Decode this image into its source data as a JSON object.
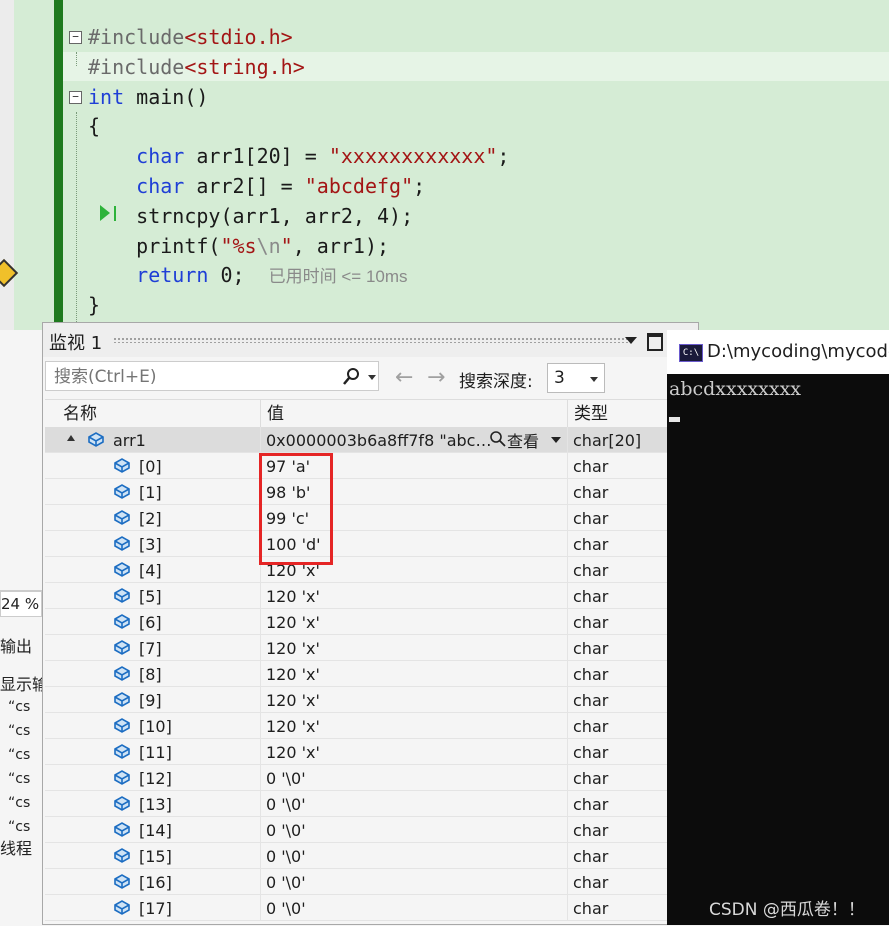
{
  "editor": {
    "lines": [
      {
        "fold": "−",
        "parts": [
          {
            "c": "inc",
            "t": "#include"
          },
          {
            "c": "ang",
            "t": "<"
          },
          {
            "c": "str",
            "t": "stdio.h"
          },
          {
            "c": "ang",
            "t": ">"
          }
        ]
      },
      {
        "parts": [
          {
            "c": "inc",
            "t": "#include"
          },
          {
            "c": "ang",
            "t": "<"
          },
          {
            "c": "str",
            "t": "string.h"
          },
          {
            "c": "ang",
            "t": ">"
          }
        ]
      },
      {
        "fold": "−",
        "parts": [
          {
            "c": "kw",
            "t": "int"
          },
          {
            "c": "",
            "t": " main()"
          }
        ]
      },
      {
        "parts": [
          {
            "c": "",
            "t": "{"
          }
        ]
      },
      {
        "parts": [
          {
            "c": "",
            "t": "    "
          },
          {
            "c": "kw",
            "t": "char"
          },
          {
            "c": "",
            "t": " arr1[20] = "
          },
          {
            "c": "str",
            "t": "\"xxxxxxxxxxxx\""
          },
          {
            "c": "",
            "t": ";"
          }
        ]
      },
      {
        "parts": [
          {
            "c": "",
            "t": "    "
          },
          {
            "c": "kw",
            "t": "char"
          },
          {
            "c": "",
            "t": " arr2[] = "
          },
          {
            "c": "str",
            "t": "\"abcdefg\""
          },
          {
            "c": "",
            "t": ";"
          }
        ]
      },
      {
        "parts": [
          {
            "c": "",
            "t": "    strncpy(arr1, arr2, 4);"
          }
        ]
      },
      {
        "parts": [
          {
            "c": "",
            "t": "    printf("
          },
          {
            "c": "str",
            "t": "\"%s"
          },
          {
            "c": "esc",
            "t": "\\n"
          },
          {
            "c": "str",
            "t": "\""
          },
          {
            "c": "",
            "t": ", arr1);"
          }
        ]
      },
      {
        "parts": [
          {
            "c": "",
            "t": "    "
          },
          {
            "c": "kw",
            "t": "return"
          },
          {
            "c": "",
            "t": " 0;  "
          },
          {
            "c": "hint",
            "t": "已用时间 <= 10ms"
          }
        ]
      },
      {
        "parts": [
          {
            "c": "",
            "t": "}"
          }
        ]
      }
    ]
  },
  "output_panel": {
    "zoom": "24 %",
    "fragments": [
      "输出",
      "显示输",
      "“cs",
      "“cs",
      "“cs",
      "“cs",
      "“cs",
      "“cs",
      "线程"
    ]
  },
  "watch": {
    "title": "监视 1",
    "search_placeholder": "搜索(Ctrl+E)",
    "depth_label": "搜索深度:",
    "depth_value": "3",
    "columns": {
      "name": "名称",
      "value": "值",
      "type": "类型"
    },
    "parent": {
      "name": "arr1",
      "value": "0x0000003b6a8ff7f8 \"abc…",
      "view": "查看",
      "type": "char[20]"
    },
    "items": [
      {
        "name": "[0]",
        "value": "97 'a'",
        "type": "char"
      },
      {
        "name": "[1]",
        "value": "98 'b'",
        "type": "char"
      },
      {
        "name": "[2]",
        "value": "99 'c'",
        "type": "char"
      },
      {
        "name": "[3]",
        "value": "100 'd'",
        "type": "char"
      },
      {
        "name": "[4]",
        "value": "120 'x'",
        "type": "char"
      },
      {
        "name": "[5]",
        "value": "120 'x'",
        "type": "char"
      },
      {
        "name": "[6]",
        "value": "120 'x'",
        "type": "char"
      },
      {
        "name": "[7]",
        "value": "120 'x'",
        "type": "char"
      },
      {
        "name": "[8]",
        "value": "120 'x'",
        "type": "char"
      },
      {
        "name": "[9]",
        "value": "120 'x'",
        "type": "char"
      },
      {
        "name": "[10]",
        "value": "120 'x'",
        "type": "char"
      },
      {
        "name": "[11]",
        "value": "120 'x'",
        "type": "char"
      },
      {
        "name": "[12]",
        "value": "0 '\\0'",
        "type": "char"
      },
      {
        "name": "[13]",
        "value": "0 '\\0'",
        "type": "char"
      },
      {
        "name": "[14]",
        "value": "0 '\\0'",
        "type": "char"
      },
      {
        "name": "[15]",
        "value": "0 '\\0'",
        "type": "char"
      },
      {
        "name": "[16]",
        "value": "0 '\\0'",
        "type": "char"
      },
      {
        "name": "[17]",
        "value": "0 '\\0'",
        "type": "char"
      }
    ]
  },
  "console": {
    "title": "D:\\mycoding\\mycode",
    "icon_text": "C:\\",
    "output": "abcdxxxxxxxx",
    "watermark": "CSDN @西瓜卷！！"
  },
  "colors": {
    "highlight_box": "#e52525",
    "editor_bg": "#d5ecd5",
    "change_bar": "#1e7a1e",
    "keyword": "#1f3fd6",
    "string": "#a31515"
  }
}
